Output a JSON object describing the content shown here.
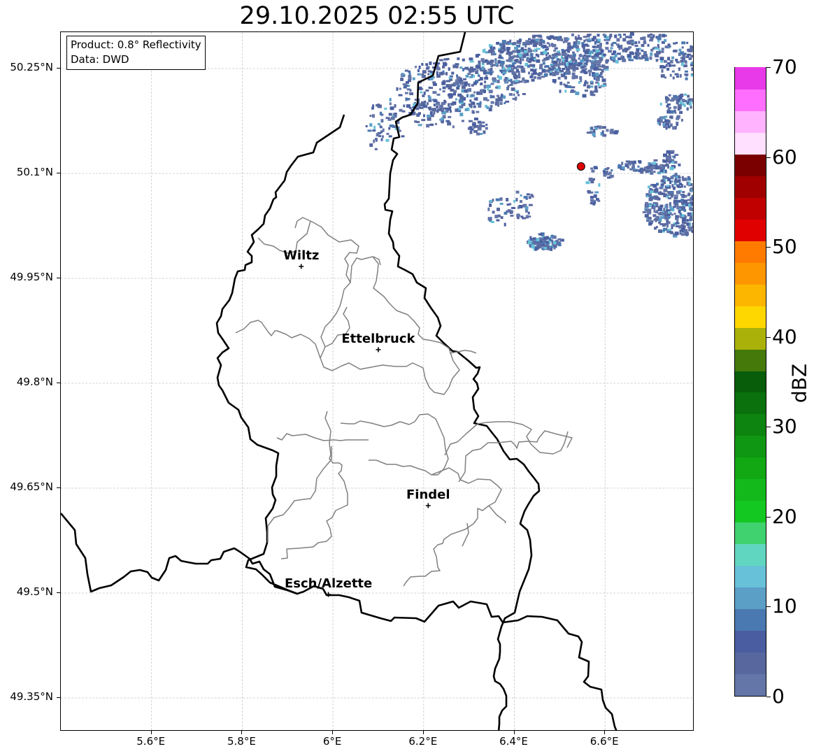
{
  "title": "29.10.2025 02:55 UTC",
  "info": {
    "product": "Product: 0.8° Reflectivity",
    "data_source": "Data: DWD"
  },
  "axes": {
    "lat_ticks": [
      "50.25°N",
      "50.1°N",
      "49.95°N",
      "49.8°N",
      "49.65°N",
      "49.5°N",
      "49.35°N"
    ],
    "lon_ticks": [
      "5.6°E",
      "5.8°E",
      "6°E",
      "6.2°E",
      "6.4°E",
      "6.6°E"
    ]
  },
  "cities": [
    {
      "name": "Wiltz",
      "lon": 5.93,
      "lat": 49.967
    },
    {
      "name": "Ettelbruck",
      "lon": 6.1,
      "lat": 49.848
    },
    {
      "name": "Findel",
      "lon": 6.21,
      "lat": 49.625
    },
    {
      "name": "Esch/Alzette",
      "lon": 5.99,
      "lat": 49.498
    }
  ],
  "radar_site": {
    "lon": 6.547,
    "lat": 50.11,
    "color": "#e10000"
  },
  "colorbar": {
    "label": "dBZ",
    "min": 0,
    "max": 70,
    "ticks": [
      "0",
      "10",
      "20",
      "30",
      "40",
      "50",
      "60",
      "70"
    ],
    "colors": [
      "#6475a8",
      "#58689f",
      "#495da0",
      "#4a78b0",
      "#5b9ec6",
      "#67c2d9",
      "#60d6c0",
      "#3fd26e",
      "#13c820",
      "#13b91b",
      "#11a813",
      "#0f9612",
      "#0d840f",
      "#0a710c",
      "#085d0a",
      "#457a0a",
      "#aab20a",
      "#fed600",
      "#fdb600",
      "#fe9600",
      "#fe7b00",
      "#e10000",
      "#c00000",
      "#a00000",
      "#7a0000",
      "#ffe0ff",
      "#ffb3ff",
      "#ff6eff",
      "#e83ae8"
    ]
  }
}
